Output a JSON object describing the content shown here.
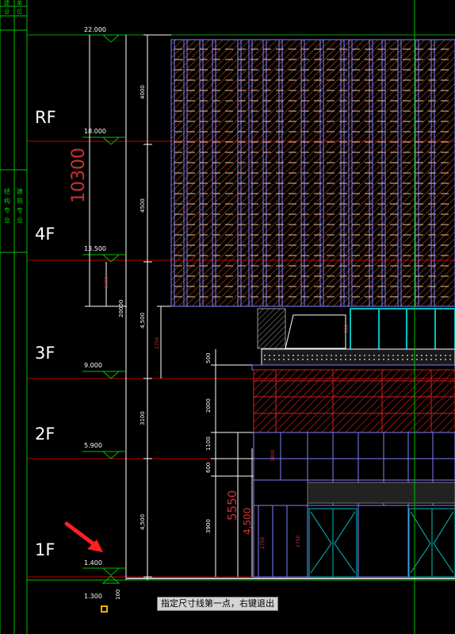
{
  "app": {
    "name": "CAD drawing window"
  },
  "floors": [
    "RF",
    "4F",
    "3F",
    "2F",
    "1F"
  ],
  "elevations": [
    "22.000",
    "18.000",
    "13.500",
    "9.000",
    "5.900",
    "1.400",
    "1.300"
  ],
  "elevation_offset_label": "100",
  "overall_dimension": "10300",
  "height_5550": "5550",
  "height_4500": "4,500",
  "vertical_dims_left": [
    "4000",
    "4500",
    "4,500",
    "3100",
    "4,500"
  ],
  "vertical_dims_right": [
    "2750",
    "500",
    "2000",
    "1100",
    "600",
    "3900"
  ],
  "small_dims": [
    "20000",
    "1800",
    "2750",
    "2750",
    "1800",
    "500",
    "2750"
  ],
  "side_table_left": [
    "结",
    "构",
    "专",
    "业"
  ],
  "side_table_right": [
    "建",
    "筑",
    "专",
    "业"
  ],
  "side_table_top": [
    "建",
    "设",
    "单",
    "位"
  ],
  "status": {
    "prompt": "指定尺寸线第一点，右键退出"
  },
  "colors": {
    "background": "#000000",
    "grid_green": "#00c000",
    "grid_red": "#c00000",
    "dim_white": "#ffffff",
    "facade_blue": "#8080ff",
    "hatch_orange": "#d06010",
    "red_text": "#c02020",
    "arrow": "#ff2020",
    "cyan": "#00e0e0"
  }
}
